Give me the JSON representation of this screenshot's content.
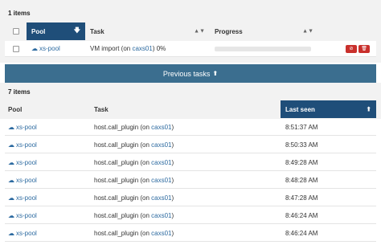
{
  "current": {
    "count_label": "1 items",
    "columns": {
      "pool": "Pool",
      "task": "Task",
      "progress": "Progress"
    },
    "rows": [
      {
        "pool": "xs-pool",
        "task_prefix": "VM import (on ",
        "task_host": "caxs01",
        "task_suffix": ") 0%"
      }
    ]
  },
  "previous": {
    "bar_label": "Previous tasks",
    "count_label": "7 items",
    "columns": {
      "pool": "Pool",
      "task": "Task",
      "last_seen": "Last seen"
    },
    "rows": [
      {
        "pool": "xs-pool",
        "task_prefix": "host.call_plugin (on ",
        "task_host": "caxs01",
        "task_suffix": ")",
        "last_seen": "8:51:37 AM"
      },
      {
        "pool": "xs-pool",
        "task_prefix": "host.call_plugin (on ",
        "task_host": "caxs01",
        "task_suffix": ")",
        "last_seen": "8:50:33 AM"
      },
      {
        "pool": "xs-pool",
        "task_prefix": "host.call_plugin (on ",
        "task_host": "caxs01",
        "task_suffix": ")",
        "last_seen": "8:49:28 AM"
      },
      {
        "pool": "xs-pool",
        "task_prefix": "host.call_plugin (on ",
        "task_host": "caxs01",
        "task_suffix": ")",
        "last_seen": "8:48:28 AM"
      },
      {
        "pool": "xs-pool",
        "task_prefix": "host.call_plugin (on ",
        "task_host": "caxs01",
        "task_suffix": ")",
        "last_seen": "8:47:28 AM"
      },
      {
        "pool": "xs-pool",
        "task_prefix": "host.call_plugin (on ",
        "task_host": "caxs01",
        "task_suffix": ")",
        "last_seen": "8:46:24 AM"
      },
      {
        "pool": "xs-pool",
        "task_prefix": "host.call_plugin (on ",
        "task_host": "caxs01",
        "task_suffix": ")",
        "last_seen": "8:46:24 AM"
      }
    ]
  },
  "colors": {
    "header_active": "#1f4e79",
    "prev_bar": "#3b6e8f",
    "link": "#2c6aa0",
    "danger": "#c9302c"
  }
}
